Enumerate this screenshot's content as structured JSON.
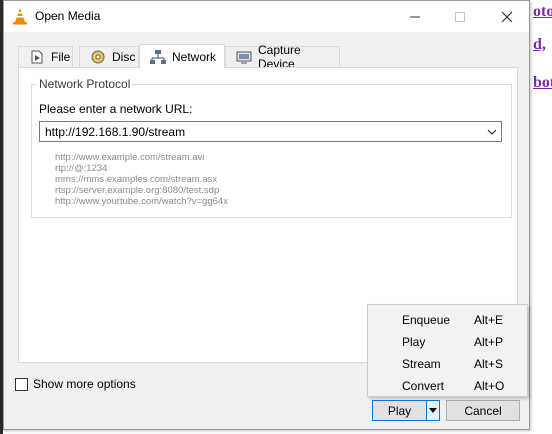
{
  "background": {
    "links": [
      "oto",
      "d,",
      "bot"
    ]
  },
  "window": {
    "title": "Open Media",
    "icon": "vlc-cone-icon",
    "controls": [
      "minimize-icon",
      "maximize-icon",
      "close-icon"
    ]
  },
  "tabs": [
    {
      "label": "File",
      "icon": "file-icon"
    },
    {
      "label": "Disc",
      "icon": "disc-icon"
    },
    {
      "label": "Network",
      "icon": "network-icon",
      "active": true
    },
    {
      "label": "Capture Device",
      "icon": "capture-device-icon"
    }
  ],
  "network": {
    "group_title": "Network Protocol",
    "url_label": "Please enter a network URL:",
    "url_value": "http://192.168.1.90/stream",
    "examples": [
      "http://www.example.com/stream.avi",
      "rtp://@:1234",
      "mms://mms.examples.com/stream.asx",
      "rtsp://server.example.org:8080/test.sdp",
      "http://www.yourtube.com/watch?v=gg64x"
    ]
  },
  "options": {
    "show_more_label": "Show more options",
    "show_more_checked": false
  },
  "buttons": {
    "play_label": "Play",
    "cancel_label": "Cancel"
  },
  "play_menu": [
    {
      "label": "Enqueue",
      "shortcut": "Alt+E"
    },
    {
      "label": "Play",
      "shortcut": "Alt+P"
    },
    {
      "label": "Stream",
      "shortcut": "Alt+S"
    },
    {
      "label": "Convert",
      "shortcut": "Alt+O"
    }
  ],
  "colors": {
    "accent": "#0078d7",
    "link_visited": "#7a2aa8",
    "vlc_orange": "#f08a00"
  }
}
